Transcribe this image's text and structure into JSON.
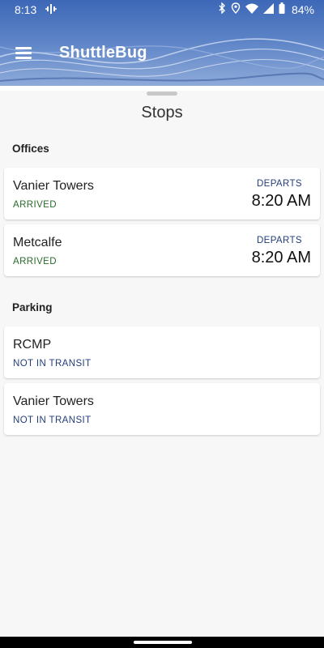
{
  "status_bar": {
    "time": "8:13",
    "battery_percent": "84%",
    "icons": [
      "podcast-icon",
      "bluetooth-icon",
      "location-icon",
      "wifi-icon",
      "signal-icon",
      "battery-icon"
    ]
  },
  "app": {
    "title": "ShuttleBug",
    "menu_icon": "menu-icon"
  },
  "sheet": {
    "title": "Stops"
  },
  "sections": [
    {
      "label": "Offices",
      "stops": [
        {
          "name": "Vanier Towers",
          "status": "ARRIVED",
          "departs_label": "DEPARTS",
          "departs_time": "8:20 AM"
        },
        {
          "name": "Metcalfe",
          "status": "ARRIVED",
          "departs_label": "DEPARTS",
          "departs_time": "8:20 AM"
        }
      ]
    },
    {
      "label": "Parking",
      "stops": [
        {
          "name": "RCMP",
          "status": "NOT IN TRANSIT"
        },
        {
          "name": "Vanier Towers",
          "status": "NOT IN TRANSIT"
        }
      ]
    }
  ],
  "colors": {
    "header_blue": "#3d68b7",
    "arrived": "#2a6a2a",
    "transit": "#233d7a"
  }
}
